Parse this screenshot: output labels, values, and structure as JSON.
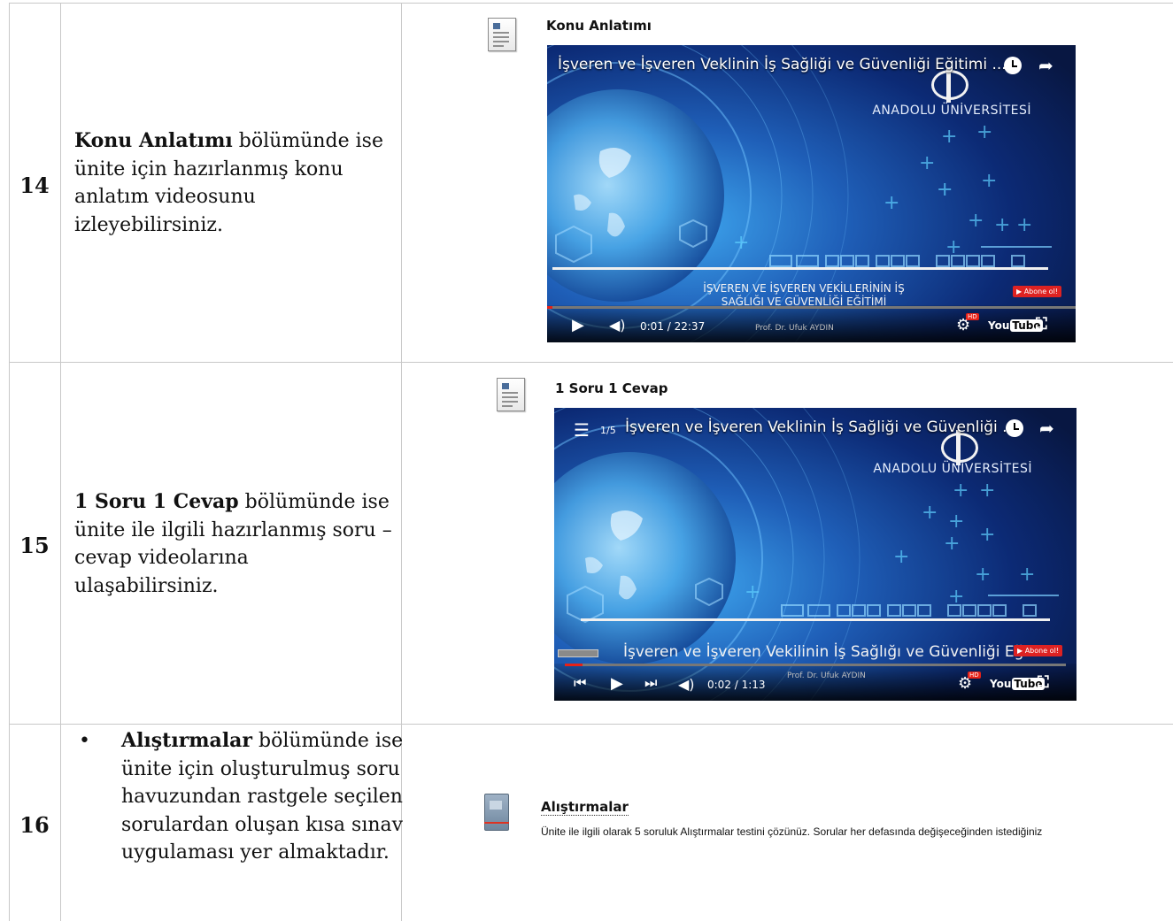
{
  "rows": [
    {
      "number": "14",
      "desc_bold": "Konu Anlatımı",
      "desc_rest": " bölümünde ise ünite için hazırlanmış konu anlatım videosunu izleyebilirsiniz.",
      "section_title": "Konu Anlatımı",
      "video": {
        "title": "İşveren ve İşveren Veklinin İş Sağliği ve Güvenliği Eğitimi ...",
        "institution": "ANADOLU ÜNİVERSİTESİ",
        "subtitle_line1": "İŞVEREN VE İŞVEREN VEKİLLERİNİN İŞ",
        "subtitle_line2": "SAĞLIĞI VE GÜVENLİĞİ EĞİTİMİ",
        "time": "0:01 / 22:37",
        "author": "Prof. Dr. Ufuk AYDIN",
        "subscribe": "Abone ol!",
        "progress": 0.01
      }
    },
    {
      "number": "15",
      "desc_bold": "1 Soru 1 Cevap",
      "desc_rest": " bölümünde ise ünite ile ilgili hazırlanmış soru – cevap videolarına ulaşabilirsiniz.",
      "section_title": "1 Soru 1 Cevap",
      "video": {
        "playlist_index": "1/5",
        "title": "İşveren ve İşveren Veklinin İş Sağliği ve Güvenliği ...",
        "institution": "ANADOLU ÜNİVERSİTESİ",
        "subtitle": "İşveren ve İşveren Vekilinin İş Sağlığı ve Güvenliği Eğitimi",
        "time": "0:02 / 1:13",
        "author": "Prof. Dr. Ufuk AYDIN",
        "subscribe": "Abone ol!",
        "progress": 0.03
      }
    },
    {
      "number": "16",
      "bullet": "•",
      "desc_bold": "Alıştırmalar",
      "desc_rest": " bölümünde ise ünite için oluşturulmuş soru havuzundan rastgele seçilen sorulardan oluşan kısa sınav uygulaması yer almaktadır.",
      "section_title": "Alıştırmalar",
      "section_desc": "Ünite ile ilgili olarak 5 soruluk Alıştırmalar testini çözünüz. Sorular her defasında değişeceğinden istediğiniz"
    }
  ],
  "icons": {
    "play": "▶",
    "volume": "🔈",
    "clock": "clock-icon",
    "share": "share-icon",
    "settings": "gear-icon",
    "fullscreen": "fullscreen-icon",
    "youtube_you": "You",
    "youtube_tube": "Tube",
    "hd": "HD"
  },
  "colors": {
    "grid": "#c8c8c8",
    "video_bg": "#0a1a45",
    "accent_red": "#e62117"
  }
}
